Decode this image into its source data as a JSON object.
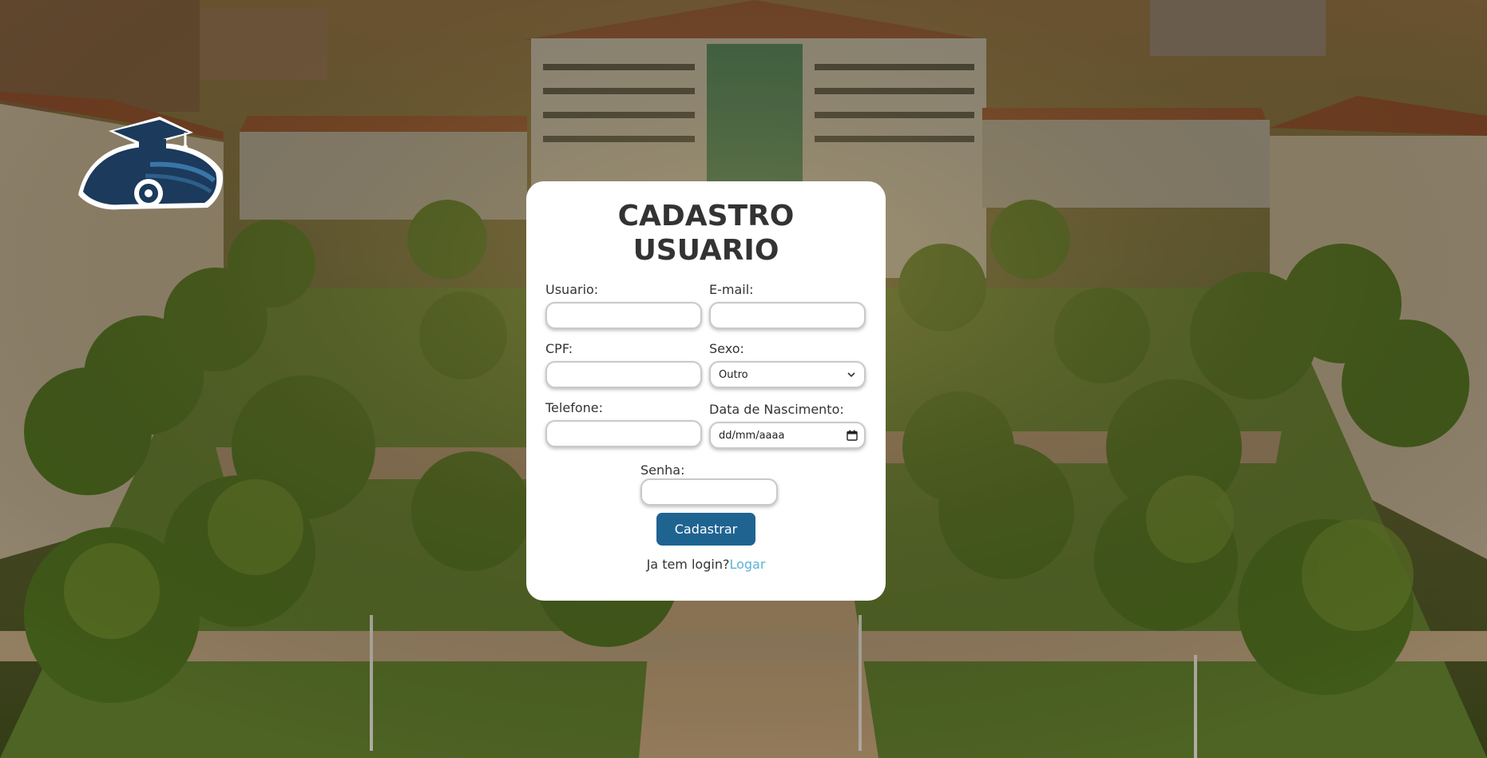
{
  "form": {
    "title_line1": "CADASTRO",
    "title_line2": "USUARIO",
    "usuario_label": "Usuario:",
    "usuario_value": "",
    "email_label": "E-mail:",
    "email_value": "",
    "cpf_label": "CPF:",
    "cpf_value": "",
    "sexo_label": "Sexo:",
    "sexo_selected": "Outro",
    "telefone_label": "Telefone:",
    "telefone_value": "",
    "nascimento_label": "Data de Nascimento:",
    "nascimento_placeholder": "dd/mm/aaaa",
    "senha_label": "Senha:",
    "senha_value": "",
    "submit_label": "Cadastrar",
    "login_prompt": "Ja tem login?",
    "login_link": "Logar"
  },
  "icons": {
    "logo": "graduation-cap-car-logo",
    "select_arrow": "chevron-down-icon",
    "calendar": "calendar-icon"
  },
  "colors": {
    "button": "#1f6391",
    "link": "#5ab4d6",
    "title": "#333333",
    "card": "#ffffff",
    "logo": "#1b3a5c"
  }
}
